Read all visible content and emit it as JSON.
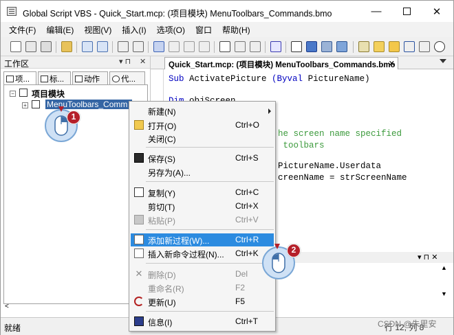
{
  "window": {
    "title": "Global Script VBS - Quick_Start.mcp: (项目模块) MenuToolbars_Commands.bmo",
    "minimize": "—",
    "close": "✕"
  },
  "menubar": [
    "文件(F)",
    "编辑(E)",
    "视图(V)",
    "插入(I)",
    "选项(O)",
    "窗口",
    "帮助(H)"
  ],
  "left_pane": {
    "title": "工作区",
    "pin": "▾ ⊓",
    "close": "✕",
    "tabs": [
      "项...",
      "标...",
      "动作",
      "代..."
    ],
    "tree": {
      "root_label": "项目模块",
      "child_label": "MenuToolbars_Comm"
    }
  },
  "editor": {
    "tab_label": "Quick_Start.mcp: (项目模块) MenuToolbars_Commands.bmo",
    "tab_close": "✕",
    "lines": [
      {
        "kw": "Sub ",
        "tx": "ActivatePicture ",
        "kw2": "(Byval ",
        "tx2": "PictureName)"
      },
      {
        "kw": "Dim ",
        "tx": "objScreen"
      },
      {
        "cm": "he screen name specified"
      },
      {
        "cm": " toolbars"
      },
      {
        "tx": "PictureName.Userdata"
      },
      {
        "tx": "creenName = strScreenName"
      }
    ]
  },
  "bottom_pane": {
    "controls": "▾ ⊓ ✕"
  },
  "context_menu": {
    "items": [
      {
        "label": "新建(N)",
        "shortcut": "",
        "submenu": true,
        "enabled": true,
        "icon": ""
      },
      {
        "label": "打开(O)",
        "shortcut": "Ctrl+O",
        "enabled": true,
        "icon": "open-folder-icon"
      },
      {
        "label": "关闭(C)",
        "shortcut": "",
        "enabled": true,
        "icon": ""
      },
      {
        "label": "保存(S)",
        "shortcut": "Ctrl+S",
        "enabled": true,
        "icon": "save-disk-icon"
      },
      {
        "label": "另存为(A)...",
        "shortcut": "",
        "enabled": true,
        "icon": ""
      },
      {
        "label": "复制(Y)",
        "shortcut": "Ctrl+C",
        "enabled": true,
        "icon": "copy-icon"
      },
      {
        "label": "剪切(T)",
        "shortcut": "Ctrl+X",
        "enabled": true,
        "icon": ""
      },
      {
        "label": "粘贴(P)",
        "shortcut": "Ctrl+V",
        "enabled": false,
        "icon": "paste-icon"
      },
      {
        "label": "添加新过程(W)...",
        "shortcut": "Ctrl+R",
        "enabled": true,
        "icon": "add-procedure-icon",
        "highlighted": true
      },
      {
        "label": "插入新命令过程(N)...",
        "shortcut": "Ctrl+K",
        "enabled": true,
        "icon": "insert-command-icon"
      },
      {
        "label": "删除(D)",
        "shortcut": "Del",
        "enabled": false,
        "icon": "delete-x-icon"
      },
      {
        "label": "重命名(R)",
        "shortcut": "F2",
        "enabled": false,
        "icon": ""
      },
      {
        "label": "更新(U)",
        "shortcut": "F5",
        "enabled": true,
        "icon": "refresh-icon"
      },
      {
        "label": "信息(I)",
        "shortcut": "Ctrl+T",
        "enabled": true,
        "icon": "info-icon"
      }
    ]
  },
  "callouts": {
    "step1": "1",
    "step2": "2"
  },
  "statusbar": {
    "text": "就绪",
    "position": "行 12, 列 8"
  },
  "watermark": "CSDN @朱里安",
  "colors": {
    "highlight": "#2c8be0",
    "tree_selection": "#3465a4",
    "keyword": "#0000c0",
    "comment": "#3c9a3c",
    "badge": "#b5202a"
  }
}
